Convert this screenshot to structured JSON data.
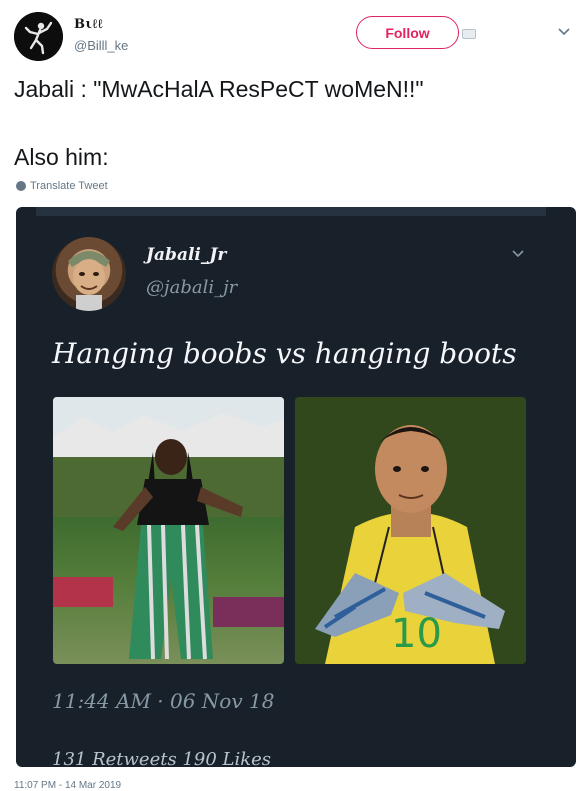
{
  "header": {
    "display_name": "Bιℓℓ",
    "handle": "@Billl_ke",
    "follow_label": "Follow"
  },
  "tweet": {
    "line1": "Jabali : \"MwAcHalA ResPeCT woMeN!!\"",
    "line2": "Also him:",
    "translate_label": "Translate Tweet"
  },
  "embedded": {
    "name": "Jabali_Jr",
    "handle": "@jabali_jr",
    "text": "Hanging boobs vs hanging boots",
    "timestamp": "11:44 AM · 06 Nov 18",
    "stats": "131 Retweets  190 Likes"
  },
  "footer": {
    "timestamp": "11:07 PM - 14 Mar 2019"
  },
  "icons": [
    "dancing-figure-avatar",
    "chevron-down-icon",
    "globe-icon",
    "cartoon-avatar"
  ],
  "colors": {
    "follow": "#e0245e",
    "embed_bg": "#18202a",
    "muted": "#657786"
  }
}
